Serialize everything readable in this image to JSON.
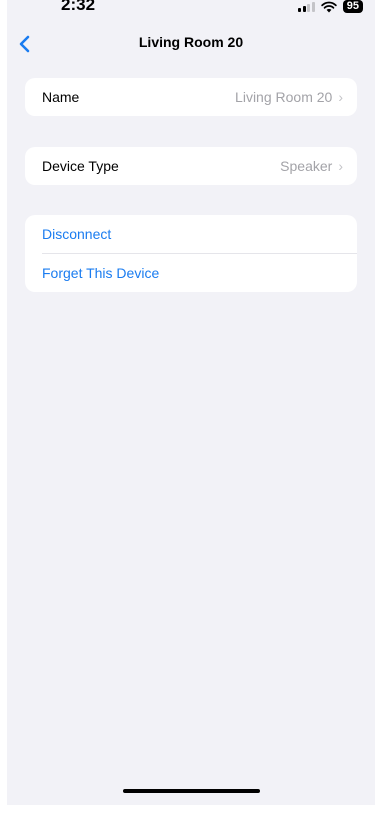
{
  "status_bar": {
    "time": "2:32",
    "battery": "95"
  },
  "nav": {
    "title": "Living Room 20"
  },
  "settings": {
    "name_label": "Name",
    "name_value": "Living Room 20",
    "device_type_label": "Device Type",
    "device_type_value": "Speaker"
  },
  "actions": {
    "disconnect": "Disconnect",
    "forget": "Forget This Device"
  },
  "colors": {
    "accent": "#1a7cf0",
    "background": "#f2f2f7",
    "secondary_text": "#a3a3a8"
  }
}
